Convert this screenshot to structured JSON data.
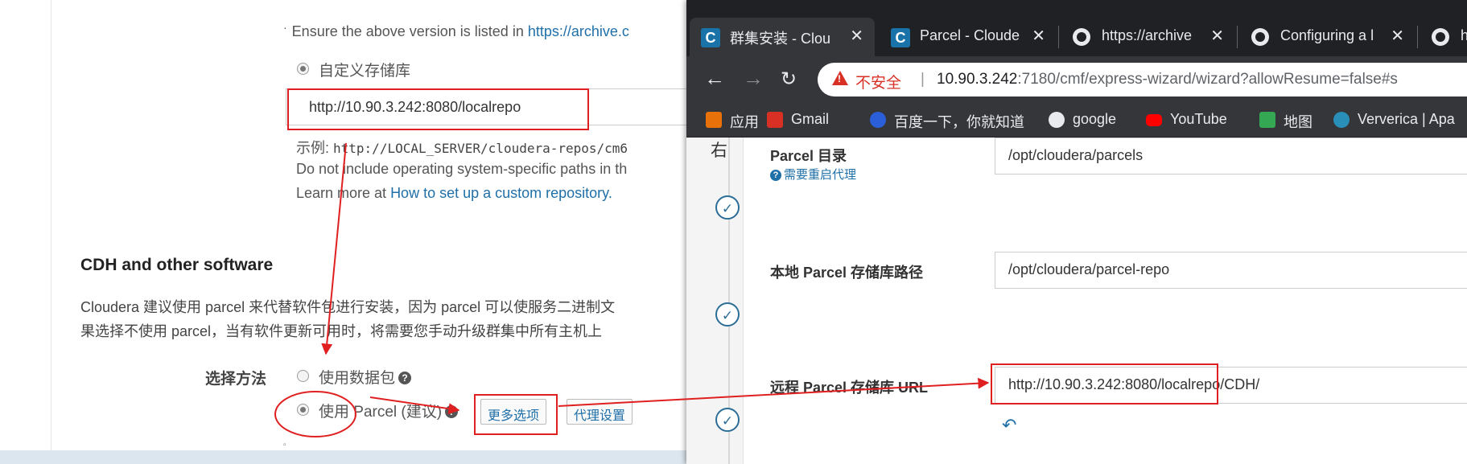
{
  "left_page": {
    "ensure_text": "Ensure the above version is listed in ",
    "ensure_link": "https://archive.c",
    "custom_repo_label": "自定义存储库",
    "repo_url_value": "http://10.90.3.242:8080/localrepo",
    "example_prefix": "示例: ",
    "example_code": "http://LOCAL_SERVER/cloudera-repos/cm6",
    "note_text": "Do not include operating system-specific paths in th",
    "learn_prefix": "Learn more at ",
    "learn_link": "How to set up a custom repository.",
    "section_title": "CDH and other software",
    "desc_line1": "Cloudera 建议使用 parcel 来代替软件包进行安装，因为 parcel 可以使服务二进制文",
    "desc_line2": "果选择不使用 parcel，当有软件更新可用时，将需要您手动升级群集中所有主机上",
    "method_label": "选择方法",
    "option_packages": "使用数据包",
    "option_parcel": "使用 Parcel (建议)",
    "more_options_button": "更多选项",
    "proxy_settings_button": "代理设置"
  },
  "browser": {
    "tabs": [
      {
        "title": "群集安装 - Clou",
        "favicon": "C",
        "active": true
      },
      {
        "title": "Parcel - Cloude",
        "favicon": "C",
        "active": false
      },
      {
        "title": "https://archive",
        "favicon": "globe-icon",
        "active": false
      },
      {
        "title": "Configuring a l",
        "favicon": "globe-icon",
        "active": false
      },
      {
        "title": "ht",
        "favicon": "globe-icon",
        "active": false
      }
    ],
    "insecure_label": "不安全",
    "url_host": "10.90.3.242",
    "url_rest": ":7180/cmf/express-wizard/wizard?allowResume=false#s",
    "bookmarks": [
      {
        "label": "应用",
        "color": "#e8710a"
      },
      {
        "label": "Gmail",
        "color": "#d93025"
      },
      {
        "label": "百度一下，你就知道",
        "color": "#2b5fd9"
      },
      {
        "label": "google",
        "color": "#e8eaed"
      },
      {
        "label": "YouTube",
        "color": "#ff0000"
      },
      {
        "label": "地图",
        "color": "#34a853"
      },
      {
        "label": "Ververica | Apa",
        "color": "#2a8fb8"
      }
    ]
  },
  "content": {
    "rail_head": "右",
    "parcel_dir_label": "Parcel 目录",
    "restart_proxy_link": "需要重启代理",
    "parcel_dir_value": "/opt/cloudera/parcels",
    "local_repo_label": "本地 Parcel 存储库路径",
    "local_repo_value": "/opt/cloudera/parcel-repo",
    "remote_repo_label": "远程 Parcel 存储库 URL",
    "remote_repo_value": "http://10.90.3.242:8080/localrepo/CDH/"
  },
  "colors": {
    "annotation_red": "#e02020",
    "link_blue": "#1f6fa8",
    "chrome_dark": "#202124"
  }
}
